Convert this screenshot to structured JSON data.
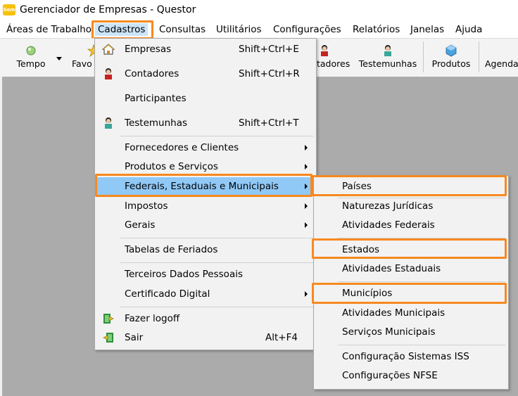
{
  "window": {
    "title": "Gerenciador de Empresas - Questor",
    "app_icon_text": "Sem"
  },
  "menubar": [
    {
      "label": "Áreas de Trabalho"
    },
    {
      "label": "Cadastros"
    },
    {
      "label": "Consultas"
    },
    {
      "label": "Utilitários"
    },
    {
      "label": "Configurações"
    },
    {
      "label": "Relatórios"
    },
    {
      "label": "Janelas"
    },
    {
      "label": "Ajuda"
    }
  ],
  "toolbar": {
    "tempo": "Tempo",
    "favo": "Favo",
    "contadores_partial": "tadores",
    "testemunhas": "Testemunhas",
    "produtos": "Produtos",
    "agenda_partial": "Agenda"
  },
  "cadastros_menu": {
    "items": [
      {
        "label": "Empresas",
        "shortcut": "Shift+Ctrl+E",
        "icon": "home-icon"
      },
      {
        "label": "Contadores",
        "shortcut": "Shift+Ctrl+R",
        "icon": "person-icon"
      },
      {
        "label": "Participantes",
        "shortcut": ""
      },
      {
        "label": "Testemunhas",
        "shortcut": "Shift+Ctrl+T",
        "icon": "person-icon"
      },
      {
        "label": "Fornecedores e Clientes",
        "submenu": true
      },
      {
        "label": "Produtos e Serviços",
        "submenu": true
      },
      {
        "label": "Federais, Estaduais e Municipais",
        "submenu": true
      },
      {
        "label": "Impostos",
        "submenu": true
      },
      {
        "label": "Gerais",
        "submenu": true
      },
      {
        "label": "Tabelas de Feriados"
      },
      {
        "label": "Terceiros Dados Pessoais"
      },
      {
        "label": "Certificado Digital",
        "submenu": true
      },
      {
        "label": "Fazer logoff",
        "icon": "logoff-icon"
      },
      {
        "label": "Sair",
        "shortcut": "Alt+F4",
        "icon": "exit-icon"
      }
    ]
  },
  "submenu": {
    "items": [
      {
        "label": "Países"
      },
      {
        "label": "Naturezas Jurídicas"
      },
      {
        "label": "Atividades Federais"
      },
      {
        "label": "Estados"
      },
      {
        "label": "Atividades Estaduais"
      },
      {
        "label": "Municípios"
      },
      {
        "label": "Atividades Municipais"
      },
      {
        "label": "Serviços Municipais"
      },
      {
        "label": "Configuração Sistemas ISS"
      },
      {
        "label": "Configurações NFSE"
      }
    ]
  },
  "colors": {
    "highlight_box": "#f7891f",
    "menu_hover": "#90c8f6",
    "workspace": "#ababab"
  }
}
